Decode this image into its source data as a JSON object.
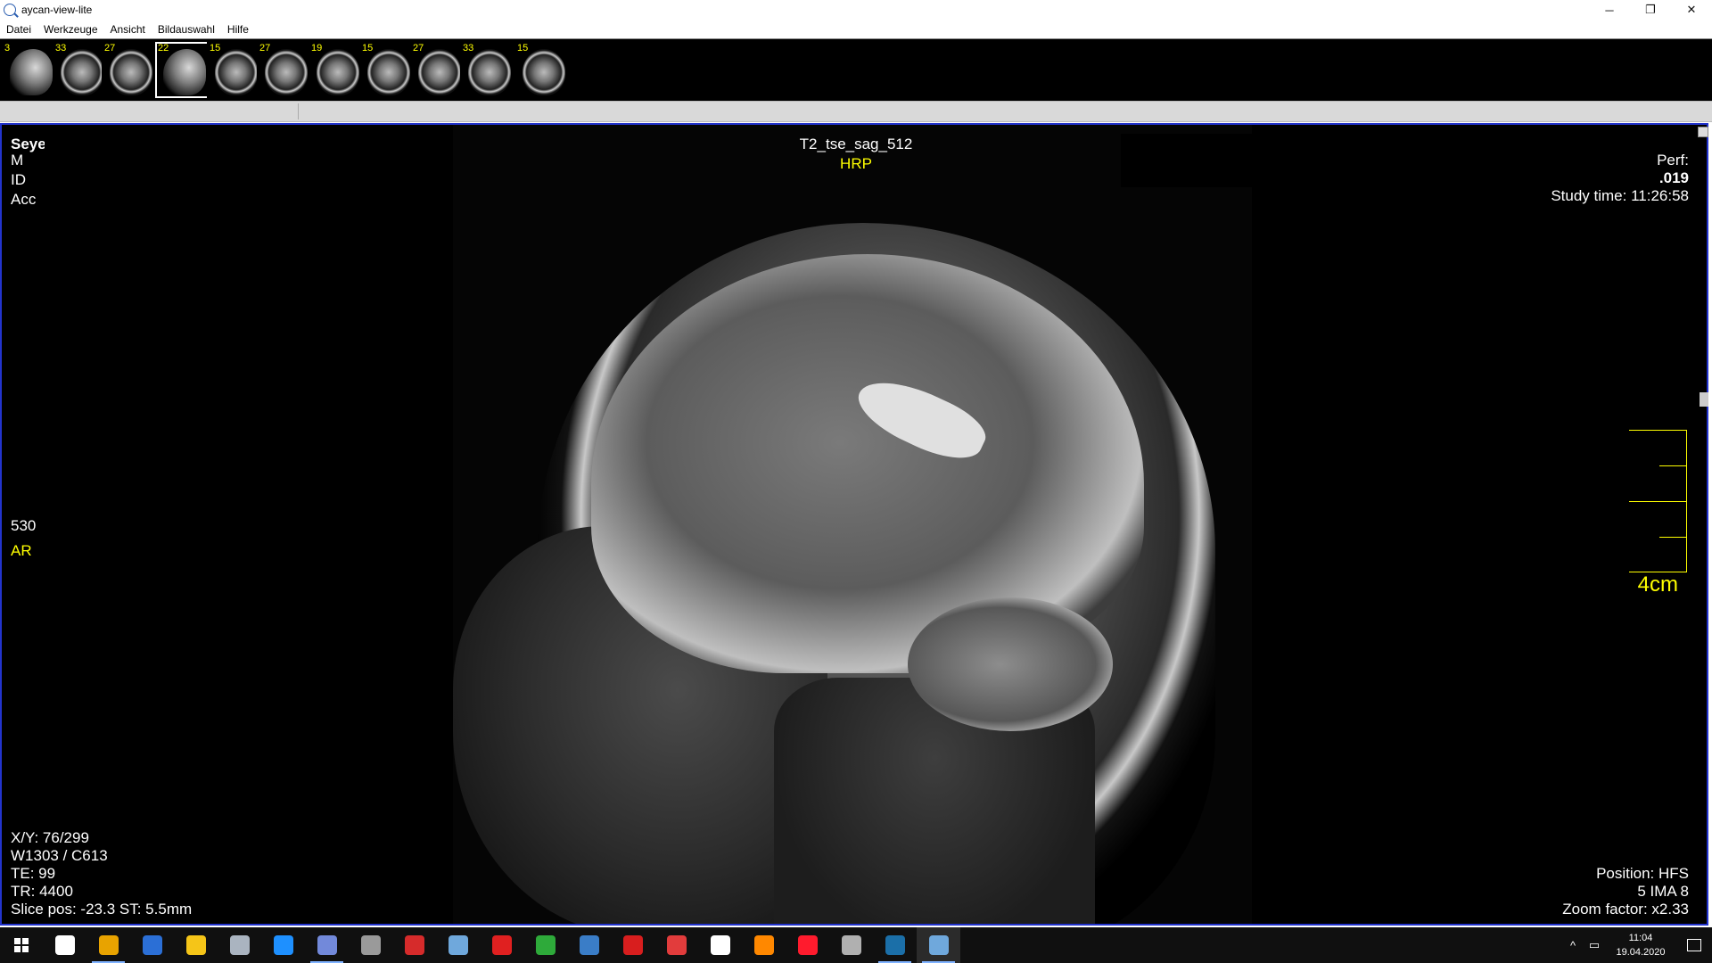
{
  "window": {
    "title": "aycan-view-lite",
    "controls": {
      "minimize": "─",
      "maximize": "❐",
      "close": "✕"
    }
  },
  "menu": [
    "Datei",
    "Werkzeuge",
    "Ansicht",
    "Bildauswahl",
    "Hilfe"
  ],
  "thumbnails": [
    {
      "count": "3",
      "kind": "sag"
    },
    {
      "count": "33",
      "kind": "axial"
    },
    {
      "count": "27",
      "kind": "axial"
    },
    {
      "count": "22",
      "kind": "sag",
      "selected": true
    },
    {
      "count": "15",
      "kind": "axial"
    },
    {
      "count": "27",
      "kind": "axial"
    },
    {
      "count": "19",
      "kind": "axial"
    },
    {
      "count": "15",
      "kind": "axial"
    },
    {
      "count": "27",
      "kind": "axial"
    },
    {
      "count": "33",
      "kind": "axial"
    },
    {
      "count": "15",
      "kind": "axial"
    }
  ],
  "viewer": {
    "series_name": "T2_tse_sag_512",
    "orientation": "HRP",
    "patient": {
      "name": "Seyer, Felix",
      "line2": "M",
      "id": "ID",
      "accession": "Acc"
    },
    "top_right": {
      "line1": "Perf:",
      "date": ".019",
      "study_time": "Study time: 11:26:58"
    },
    "left_marker": {
      "number": "530",
      "orientation": "AR"
    },
    "bottom_left": [
      "X/Y: 76/299",
      "W1303 / C613",
      "TE: 99",
      "TR: 4400",
      "Slice pos: -23.3  ST: 5.5mm"
    ],
    "bottom_right": [
      "Position: HFS",
      "5 IMA 8",
      "Zoom factor: x2.33"
    ],
    "ruler_label": "4cm"
  },
  "taskbar": {
    "apps": [
      {
        "name": "task-view-icon",
        "color": "#ffffff"
      },
      {
        "name": "chrome-icon",
        "color": "#e8a300",
        "active": true
      },
      {
        "name": "word-icon",
        "color": "#2b6fd6"
      },
      {
        "name": "file-explorer-icon",
        "color": "#f5c518"
      },
      {
        "name": "gamepad-icon",
        "color": "#aab4c0"
      },
      {
        "name": "uplay-icon",
        "color": "#1e90ff"
      },
      {
        "name": "discord-icon",
        "color": "#7289da",
        "active": true
      },
      {
        "name": "spider-icon",
        "color": "#9a9a9a"
      },
      {
        "name": "flash-icon",
        "color": "#d62b2b"
      },
      {
        "name": "notepad-icon",
        "color": "#6fa8dc"
      },
      {
        "name": "speedometer-icon",
        "color": "#e02020"
      },
      {
        "name": "globe-icon",
        "color": "#2eaa3a"
      },
      {
        "name": "k-app-icon",
        "color": "#3a7dc7"
      },
      {
        "name": "acrobat-icon",
        "color": "#d81e1e"
      },
      {
        "name": "pdf-reader-icon",
        "color": "#e23c3c"
      },
      {
        "name": "settings-icon",
        "color": "#ffffff"
      },
      {
        "name": "vlc-icon",
        "color": "#ff8800"
      },
      {
        "name": "opera-icon",
        "color": "#ff1b2d"
      },
      {
        "name": "shield-game-icon",
        "color": "#b0b0b0"
      },
      {
        "name": "steam-icon",
        "color": "#1b6fa8",
        "active": true
      },
      {
        "name": "aycan-viewer-icon",
        "color": "#6fa8dc",
        "active": true,
        "open": true
      }
    ],
    "tray": {
      "chevron": "^",
      "network": "▭",
      "time": "11:04",
      "date": "19.04.2020"
    }
  }
}
